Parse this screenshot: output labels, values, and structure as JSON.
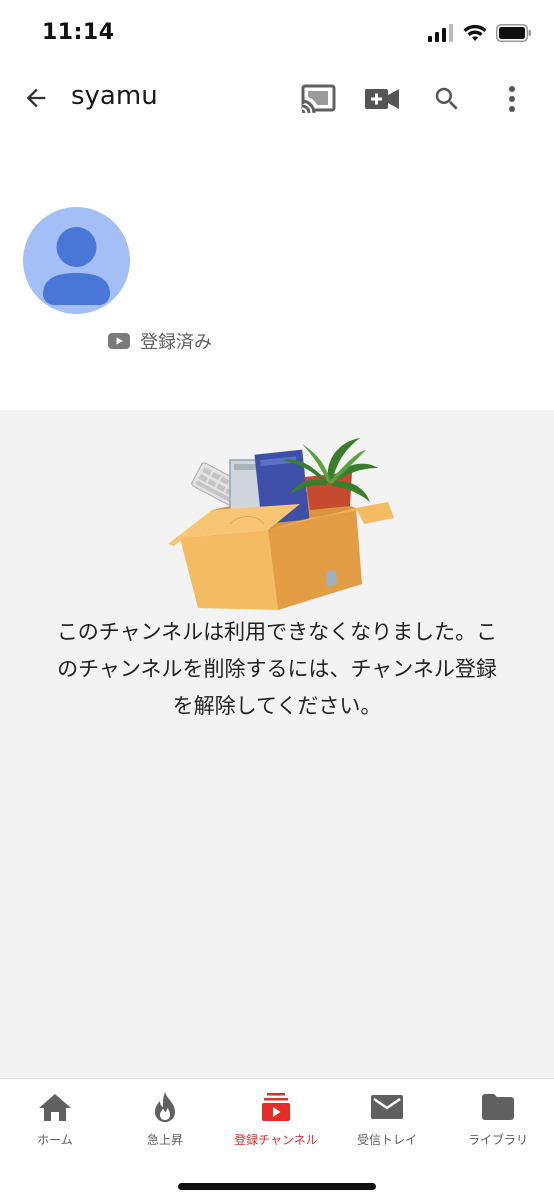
{
  "status_bar": {
    "time": "11:14"
  },
  "app_bar": {
    "title": "syamu",
    "icons": [
      "back-arrow-icon",
      "cast-icon",
      "video-camera-add-icon",
      "search-icon",
      "more-vertical-icon"
    ]
  },
  "channel": {
    "subscribed_label": "登録済み"
  },
  "main": {
    "message_lines": [
      "このチャンネルは利用できなくなりました。こ",
      "のチャンネルを削除するには、チャンネル登録",
      "を解除してください。"
    ]
  },
  "bottom_nav": {
    "items": [
      {
        "label": "ホーム",
        "icon": "home-icon",
        "active": false
      },
      {
        "label": "急上昇",
        "icon": "flame-icon",
        "active": false
      },
      {
        "label": "登録チャンネル",
        "icon": "subscriptions-icon",
        "active": true
      },
      {
        "label": "受信トレイ",
        "icon": "mail-icon",
        "active": false
      },
      {
        "label": "ライブラリ",
        "icon": "folder-icon",
        "active": false
      }
    ]
  },
  "colors": {
    "accent": "#e52d27",
    "avatar_bg": "#a4bff6",
    "avatar_figure": "#4877d8",
    "main_bg": "#f3f3f3",
    "icon_gray": "#606060"
  }
}
